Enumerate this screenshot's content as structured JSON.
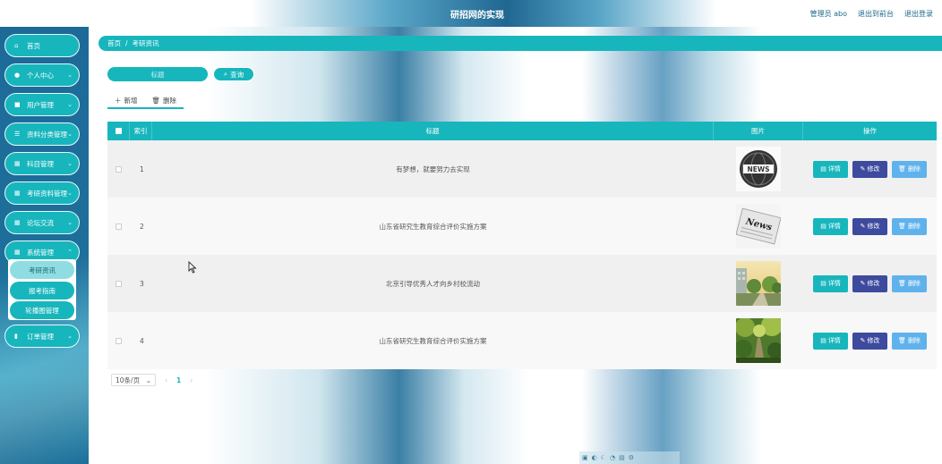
{
  "header": {
    "title": "研招网的实现",
    "links": [
      "管理员 abo",
      "退出到前台",
      "退出登录"
    ]
  },
  "sidebar": {
    "items": [
      {
        "label": "首页",
        "icon": "home-icon",
        "chevron": false
      },
      {
        "label": "个人中心",
        "icon": "user-icon",
        "chevron": true
      },
      {
        "label": "用户管理",
        "icon": "comment-icon",
        "chevron": true
      },
      {
        "label": "资料分类管理",
        "icon": "list-icon",
        "chevron": true
      },
      {
        "label": "科目管理",
        "icon": "grid-icon",
        "chevron": true
      },
      {
        "label": "考研资料管理",
        "icon": "grid-icon",
        "chevron": true
      },
      {
        "label": "论坛交流",
        "icon": "grid-icon",
        "chevron": true
      },
      {
        "label": "系统管理",
        "icon": "grid-icon",
        "chevron": true
      },
      {
        "label": "订单管理",
        "icon": "file-icon",
        "chevron": true
      }
    ],
    "sub_items": [
      "考研资讯",
      "报考指南",
      "轮播图管理"
    ]
  },
  "breadcrumb": [
    "首页",
    "/",
    "考研资讯"
  ],
  "search": {
    "placeholder": "标题",
    "button_label": "查询"
  },
  "tabs": {
    "add_label": "新增",
    "delete_label": "删除"
  },
  "table": {
    "headers": [
      "索引",
      "标题",
      "图片",
      "操作"
    ],
    "rows": [
      {
        "index": "1",
        "title": "有梦想，就要努力去实现",
        "image": "news-globe-image"
      },
      {
        "index": "2",
        "title": "山东省研究生教育综合评价实施方案",
        "image": "news-paper-image"
      },
      {
        "index": "3",
        "title": "北京引导优秀人才向乡村校流动",
        "image": "campus-street-image"
      },
      {
        "index": "4",
        "title": "山东省研究生教育综合评价实施方案",
        "image": "park-path-image"
      }
    ],
    "actions": {
      "detail": "详情",
      "edit": "修改",
      "delete": "删除"
    }
  },
  "pagination": {
    "page_size": "10条/页",
    "current_page": "1"
  },
  "colors": {
    "primary": "#17b6bd",
    "edit": "#3d4a9e",
    "delete": "#5fb2ec",
    "sidebar": "#1d6a98"
  }
}
